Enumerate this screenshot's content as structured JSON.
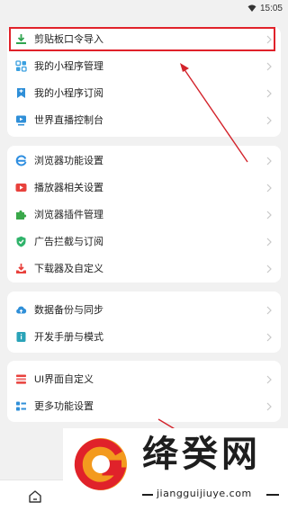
{
  "status_bar": {
    "time": "15:05",
    "wifi_icon": "wifi-icon"
  },
  "groups": [
    {
      "items": [
        {
          "label": "剪贴板口令导入",
          "icon": "download-icon",
          "color": "#2fa44f"
        },
        {
          "label": "我的小程序管理",
          "icon": "grid-icon",
          "color": "#3aa0e0"
        },
        {
          "label": "我的小程序订阅",
          "icon": "bookmark-icon",
          "color": "#2f8fd8"
        },
        {
          "label": "世界直播控制台",
          "icon": "tv-icon",
          "color": "#2f8fd8"
        }
      ]
    },
    {
      "items": [
        {
          "label": "浏览器功能设置",
          "icon": "browser-icon",
          "color": "#2e8ee0"
        },
        {
          "label": "播放器相关设置",
          "icon": "play-icon",
          "color": "#e8413c"
        },
        {
          "label": "浏览器插件管理",
          "icon": "puzzle-icon",
          "color": "#3aa84a"
        },
        {
          "label": "广告拦截与订阅",
          "icon": "shield-icon",
          "color": "#2fb36a"
        },
        {
          "label": "下载器及自定义",
          "icon": "download-tray-icon",
          "color": "#e8413c"
        }
      ]
    },
    {
      "items": [
        {
          "label": "数据备份与同步",
          "icon": "cloud-icon",
          "color": "#2f8fd8"
        },
        {
          "label": "开发手册与模式",
          "icon": "book-icon",
          "color": "#2aa3b8"
        }
      ]
    },
    {
      "items": [
        {
          "label": "UI界面自定义",
          "icon": "ui-icon",
          "color": "#e8413c"
        },
        {
          "label": "更多功能设置",
          "icon": "more-icon",
          "color": "#2f8fd8"
        }
      ]
    }
  ],
  "annotation": {
    "highlight_color": "#e0222a"
  },
  "bottom_nav": {
    "home_icon": "home-icon"
  },
  "watermark": {
    "title": "绛癸网",
    "url": "jiangguijiuye.com"
  }
}
